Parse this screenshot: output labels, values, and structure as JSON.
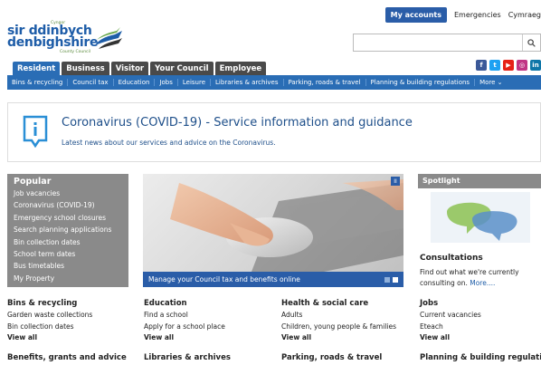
{
  "header": {
    "my_accounts": "My accounts",
    "emergencies": "Emergencies",
    "language": "Cymraeg",
    "logo": {
      "line1": "sir ddinbych",
      "line2": "denbighshire",
      "council_top": "Cyngor",
      "council_bottom": "County Council"
    },
    "search": {
      "placeholder": "",
      "icon": "search-icon"
    }
  },
  "tabs": [
    {
      "label": "Resident",
      "active": true
    },
    {
      "label": "Business"
    },
    {
      "label": "Visitor"
    },
    {
      "label": "Your Council"
    },
    {
      "label": "Employee"
    }
  ],
  "social": [
    {
      "name": "facebook-icon",
      "glyph": "f",
      "color": "#3b5998"
    },
    {
      "name": "twitter-icon",
      "glyph": "t",
      "color": "#1da1f2"
    },
    {
      "name": "youtube-icon",
      "glyph": "▶",
      "color": "#e62117"
    },
    {
      "name": "instagram-icon",
      "glyph": "◎",
      "color": "#c13584"
    },
    {
      "name": "linkedin-icon",
      "glyph": "in",
      "color": "#0e76a8"
    }
  ],
  "subnav": [
    "Bins & recycling",
    "Council tax",
    "Education",
    "Jobs",
    "Leisure",
    "Libraries & archives",
    "Parking, roads & travel",
    "Planning & building regulations",
    "More ⌄"
  ],
  "covid": {
    "title": "Coronavirus (COVID-19) - Service information and guidance",
    "subtitle": "Latest news about our services and advice on the Coronavirus."
  },
  "popular": {
    "title": "Popular",
    "items": [
      "Job vacancies",
      "Coronavirus (COVID-19)",
      "Emergency school closures",
      "Search planning applications",
      "Bin collection dates",
      "School term dates",
      "Bus timetables",
      "My Property"
    ]
  },
  "hero": {
    "caption": "Manage your Council tax and benefits online",
    "pause": "II"
  },
  "spotlight": {
    "header": "Spotlight",
    "title": "Consultations",
    "text": "Find out what we're currently consulting on.",
    "more": "More...."
  },
  "columns": [
    {
      "title": "Bins & recycling",
      "items": [
        "Garden waste collections",
        "Bin collection dates"
      ],
      "view": "View all"
    },
    {
      "title": "Education",
      "items": [
        "Find a school",
        "Apply for a school place"
      ],
      "view": "View all"
    },
    {
      "title": "Health & social care",
      "items": [
        "Adults",
        "Children, young people & families"
      ],
      "view": "View all"
    },
    {
      "title": "Jobs",
      "items": [
        "Current vacancies",
        "Eteach"
      ],
      "view": "View all"
    }
  ],
  "row2": [
    "Benefits, grants and advice",
    "Libraries & archives",
    "Parking, roads & travel",
    "Planning & building regulations"
  ],
  "colors": {
    "brand_blue": "#2a6db5",
    "dark_blue": "#2a5da8",
    "grey_panel": "#8a8a8a"
  }
}
